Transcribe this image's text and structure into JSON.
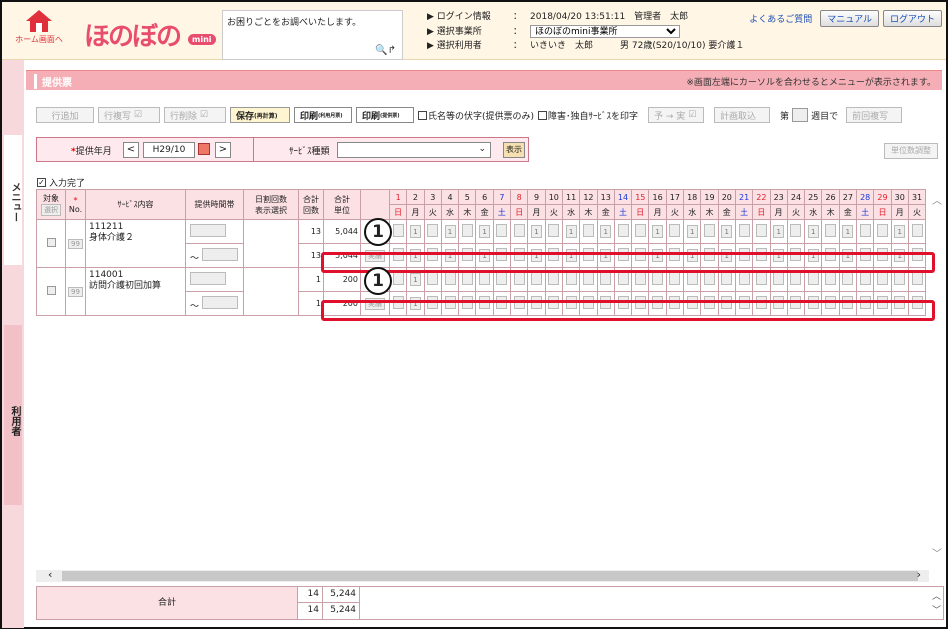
{
  "header": {
    "home_label": "ホーム画面へ",
    "logo_text": "ほのぼの",
    "logo_badge": "mini",
    "help_text": "お困りごとをお調べいたします。",
    "login_label": "ログイン情報",
    "login_value": "2018/04/20 13:51:11　管理者　太郎",
    "office_label": "選択事業所",
    "office_value": "ほのぼのmini事業所",
    "user_label": "選択利用者",
    "user_value": "いきいき　太郎　　　男 72歳(S20/10/10) 要介護１",
    "faq_link": "よくあるご質問",
    "manual_button": "マニュアル",
    "logout_button": "ログアウト"
  },
  "side": {
    "menu_tab": "メニュー",
    "user_tab": "利用者"
  },
  "title": {
    "text": "提供票",
    "notice": "※画面左端にカーソルを合わせるとメニューが表示されます。"
  },
  "toolbar": {
    "add_row": "行追加",
    "copy_row": "行複写",
    "delete_row": "行削除",
    "save": "保存",
    "save_sub": "(再計算)",
    "print_user": "印刷",
    "print_user_sub": "(利用月票)",
    "print_provider": "印刷",
    "print_provider_sub": "(提供票)",
    "name_only_check": "氏名等の伏字(提供票のみ)",
    "print_disability_check": "障害･独自ｻｰﾋﾞｽを印字",
    "plan_to_actual": "予 → 実",
    "plan_import": "計画取込",
    "week_prefix": "第",
    "week_suffix": "週目で",
    "prev_copy": "前回複写"
  },
  "filter": {
    "month_label": "提供年月",
    "required_mark": "*",
    "month_value": "H29/10",
    "service_type_label": "ｻｰﾋﾞｽ種類",
    "show_button": "表示",
    "unit_adjust": "単位数調整"
  },
  "input_done": "入力完了",
  "table": {
    "h_target": "対象",
    "h_select": "選択",
    "h_no": "No.",
    "h_service": "ｻｰﾋﾞｽ内容",
    "h_time": "提供時間帯",
    "h_daily": "日割回数\n表示選択",
    "h_total_count": "合計\n回数",
    "h_total_units": "合計\n単位",
    "days": [
      {
        "d": "1",
        "w": "日",
        "t": "sun"
      },
      {
        "d": "2",
        "w": "月",
        "t": ""
      },
      {
        "d": "3",
        "w": "火",
        "t": ""
      },
      {
        "d": "4",
        "w": "水",
        "t": ""
      },
      {
        "d": "5",
        "w": "木",
        "t": ""
      },
      {
        "d": "6",
        "w": "金",
        "t": ""
      },
      {
        "d": "7",
        "w": "土",
        "t": "sat"
      },
      {
        "d": "8",
        "w": "日",
        "t": "sun"
      },
      {
        "d": "9",
        "w": "月",
        "t": ""
      },
      {
        "d": "10",
        "w": "火",
        "t": ""
      },
      {
        "d": "11",
        "w": "水",
        "t": ""
      },
      {
        "d": "12",
        "w": "木",
        "t": ""
      },
      {
        "d": "13",
        "w": "金",
        "t": ""
      },
      {
        "d": "14",
        "w": "土",
        "t": "sat"
      },
      {
        "d": "15",
        "w": "日",
        "t": "sun"
      },
      {
        "d": "16",
        "w": "月",
        "t": ""
      },
      {
        "d": "17",
        "w": "火",
        "t": ""
      },
      {
        "d": "18",
        "w": "水",
        "t": ""
      },
      {
        "d": "19",
        "w": "木",
        "t": ""
      },
      {
        "d": "20",
        "w": "金",
        "t": ""
      },
      {
        "d": "21",
        "w": "土",
        "t": "sat"
      },
      {
        "d": "22",
        "w": "日",
        "t": "sun"
      },
      {
        "d": "23",
        "w": "月",
        "t": ""
      },
      {
        "d": "24",
        "w": "火",
        "t": ""
      },
      {
        "d": "25",
        "w": "水",
        "t": ""
      },
      {
        "d": "26",
        "w": "木",
        "t": ""
      },
      {
        "d": "27",
        "w": "金",
        "t": ""
      },
      {
        "d": "28",
        "w": "土",
        "t": "sat"
      },
      {
        "d": "29",
        "w": "日",
        "t": "sun"
      },
      {
        "d": "30",
        "w": "月",
        "t": ""
      },
      {
        "d": "31",
        "w": "火",
        "t": ""
      }
    ],
    "rows": [
      {
        "no": "99",
        "code": "111211",
        "name": "身体介護２",
        "tilde": "～",
        "plan_count": "13",
        "plan_units": "5,044",
        "act_count": "13",
        "act_units": "5,044",
        "act_btn": "実績",
        "plan_days": [
          2,
          4,
          6,
          9,
          11,
          13,
          16,
          18,
          20,
          23,
          25,
          27,
          30
        ],
        "act_days": [
          2,
          4,
          6,
          9,
          11,
          13,
          16,
          18,
          20,
          23,
          25,
          27,
          30
        ]
      },
      {
        "no": "99",
        "code": "114001",
        "name": "訪問介護初回加算",
        "tilde": "～",
        "plan_count": "1",
        "plan_units": "200",
        "act_count": "1",
        "act_units": "200",
        "act_btn": "実績",
        "plan_days": [
          2
        ],
        "act_days": [
          2
        ]
      }
    ],
    "day_mark": "1"
  },
  "callouts": [
    "1",
    "1"
  ],
  "totals": {
    "label": "合計",
    "count1": "14",
    "units1": "5,244",
    "count2": "14",
    "units2": "5,244"
  },
  "colors": {
    "accent_pink": "#f5aeb6",
    "highlight_red": "#e0102c",
    "logo_pink": "#e94d6e"
  }
}
